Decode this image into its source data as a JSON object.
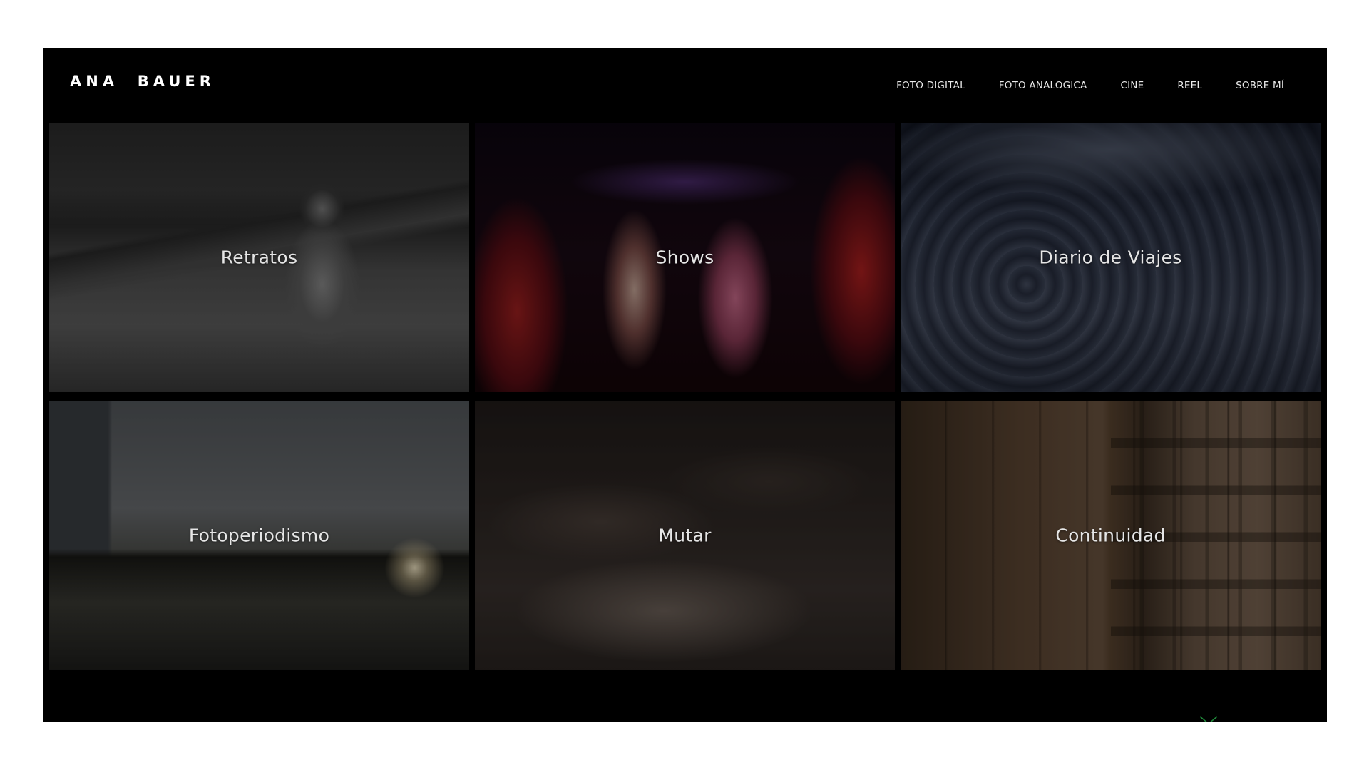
{
  "site": {
    "logo": "ANA  BAUER"
  },
  "nav": {
    "items": [
      {
        "label": "FOTO DIGITAL"
      },
      {
        "label": "FOTO ANALOGICA"
      },
      {
        "label": "CINE"
      },
      {
        "label": "REEL"
      },
      {
        "label": "SOBRE MÍ"
      }
    ]
  },
  "gallery": {
    "tiles": [
      {
        "label": "Retratos"
      },
      {
        "label": "Shows"
      },
      {
        "label": "Diario de Viajes"
      },
      {
        "label": "Fotoperiodismo"
      },
      {
        "label": "Mutar"
      },
      {
        "label": "Continuidad"
      }
    ]
  },
  "colors": {
    "background": "#ffffff",
    "site_background": "#000000",
    "text": "#e6e6e6",
    "footer_mark": "#1f8a3a"
  },
  "icons": {
    "footer_mark": "chevron-down-icon"
  }
}
